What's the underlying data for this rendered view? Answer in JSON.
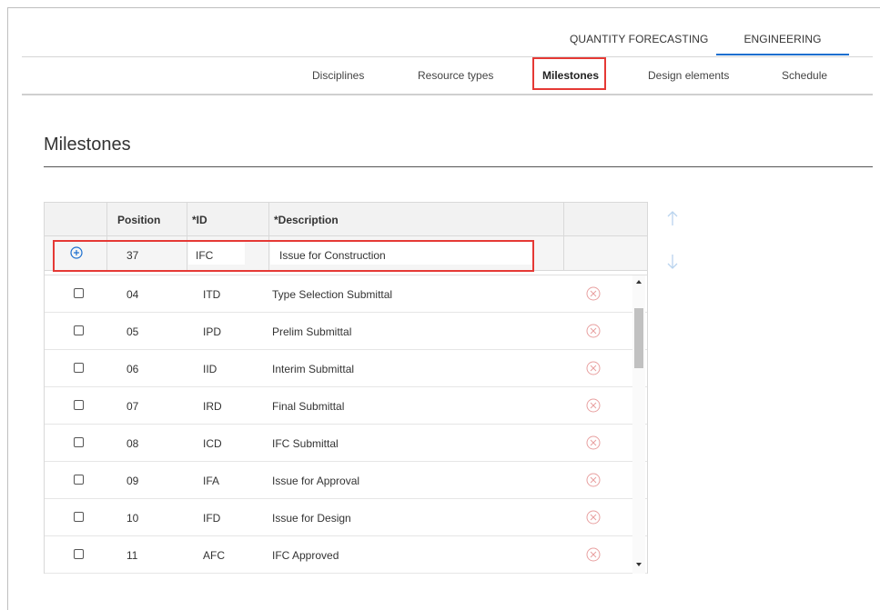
{
  "top_tabs": {
    "quantity_forecasting": "QUANTITY FORECASTING",
    "engineering": "ENGINEERING"
  },
  "sub_nav": {
    "disciplines": "Disciplines",
    "resource_types": "Resource types",
    "milestones": "Milestones",
    "design_elements": "Design elements",
    "schedule": "Schedule"
  },
  "page": {
    "title": "Milestones"
  },
  "table": {
    "headers": {
      "position": "Position",
      "id": "*ID",
      "description": "*Description"
    },
    "new_row": {
      "position": "37",
      "id": "IFC",
      "description": "Issue for Construction"
    },
    "rows": [
      {
        "position": "04",
        "id": "ITD",
        "description": "Type Selection Submittal"
      },
      {
        "position": "05",
        "id": "IPD",
        "description": "Prelim Submittal"
      },
      {
        "position": "06",
        "id": "IID",
        "description": "Interim Submittal"
      },
      {
        "position": "07",
        "id": "IRD",
        "description": "Final Submittal"
      },
      {
        "position": "08",
        "id": "ICD",
        "description": "IFC Submittal"
      },
      {
        "position": "09",
        "id": "IFA",
        "description": "Issue for Approval"
      },
      {
        "position": "10",
        "id": "IFD",
        "description": "Issue for Design"
      },
      {
        "position": "11",
        "id": "AFC",
        "description": "IFC Approved"
      }
    ]
  },
  "icons": {
    "add": "plus-circle-icon",
    "delete": "x-circle-icon",
    "move_up": "arrow-up-icon",
    "move_down": "arrow-down-icon"
  },
  "colors": {
    "accent": "#1c6fcf",
    "highlight": "#e53935",
    "delete_icon": "#e8a0a0",
    "arrow_icon": "#b9d3ee"
  }
}
